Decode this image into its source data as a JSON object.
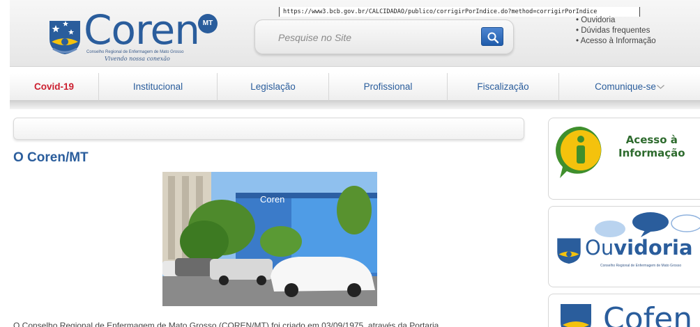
{
  "address_bar": {
    "url": "https://www3.bcb.gov.br/CALCIDADAO/publico/corrigirPorIndice.do?method=corrigirPorIndice"
  },
  "logo": {
    "wordmark": "Coren",
    "badge": "MT",
    "subtitle": "Conselho Regional de Enfermagem de Mato Grosso",
    "tagline": "Vivendo nossa conexão"
  },
  "search": {
    "placeholder": "Pesquise no Site",
    "value": ""
  },
  "quick_links": [
    "Ouvidoria",
    "Dúvidas frequentes",
    "Acesso à Informação"
  ],
  "nav": {
    "items": [
      {
        "label": "Covid-19",
        "active": true
      },
      {
        "label": "Institucional",
        "active": false
      },
      {
        "label": "Legislação",
        "active": false
      },
      {
        "label": "Profissional",
        "active": false
      },
      {
        "label": "Fiscalização",
        "active": false
      },
      {
        "label": "Comunique-se",
        "active": false,
        "has_dropdown": true
      }
    ]
  },
  "main": {
    "title": "O Coren/MT",
    "photo_sign": "Coren",
    "body_text": "O Conselho Regional de Enfermagem de Mato Grosso (COREN/MT) foi criado em 03/09/1975, através da Portaria"
  },
  "sidebar": {
    "acesso_line1": "Acesso à",
    "acesso_line2": "Informação",
    "ouvidoria_part1": "Ou",
    "ouvidoria_part2": "vidoria",
    "ouvidoria_sub": "Conselho Regional de Enfermagem de Mato Grosso",
    "coren_word": "Cofen"
  },
  "colors": {
    "brand_blue": "#2a5d9c",
    "active_red": "#cc1f2f",
    "info_green": "#3f8f2c",
    "info_yellow": "#f4c20d"
  }
}
